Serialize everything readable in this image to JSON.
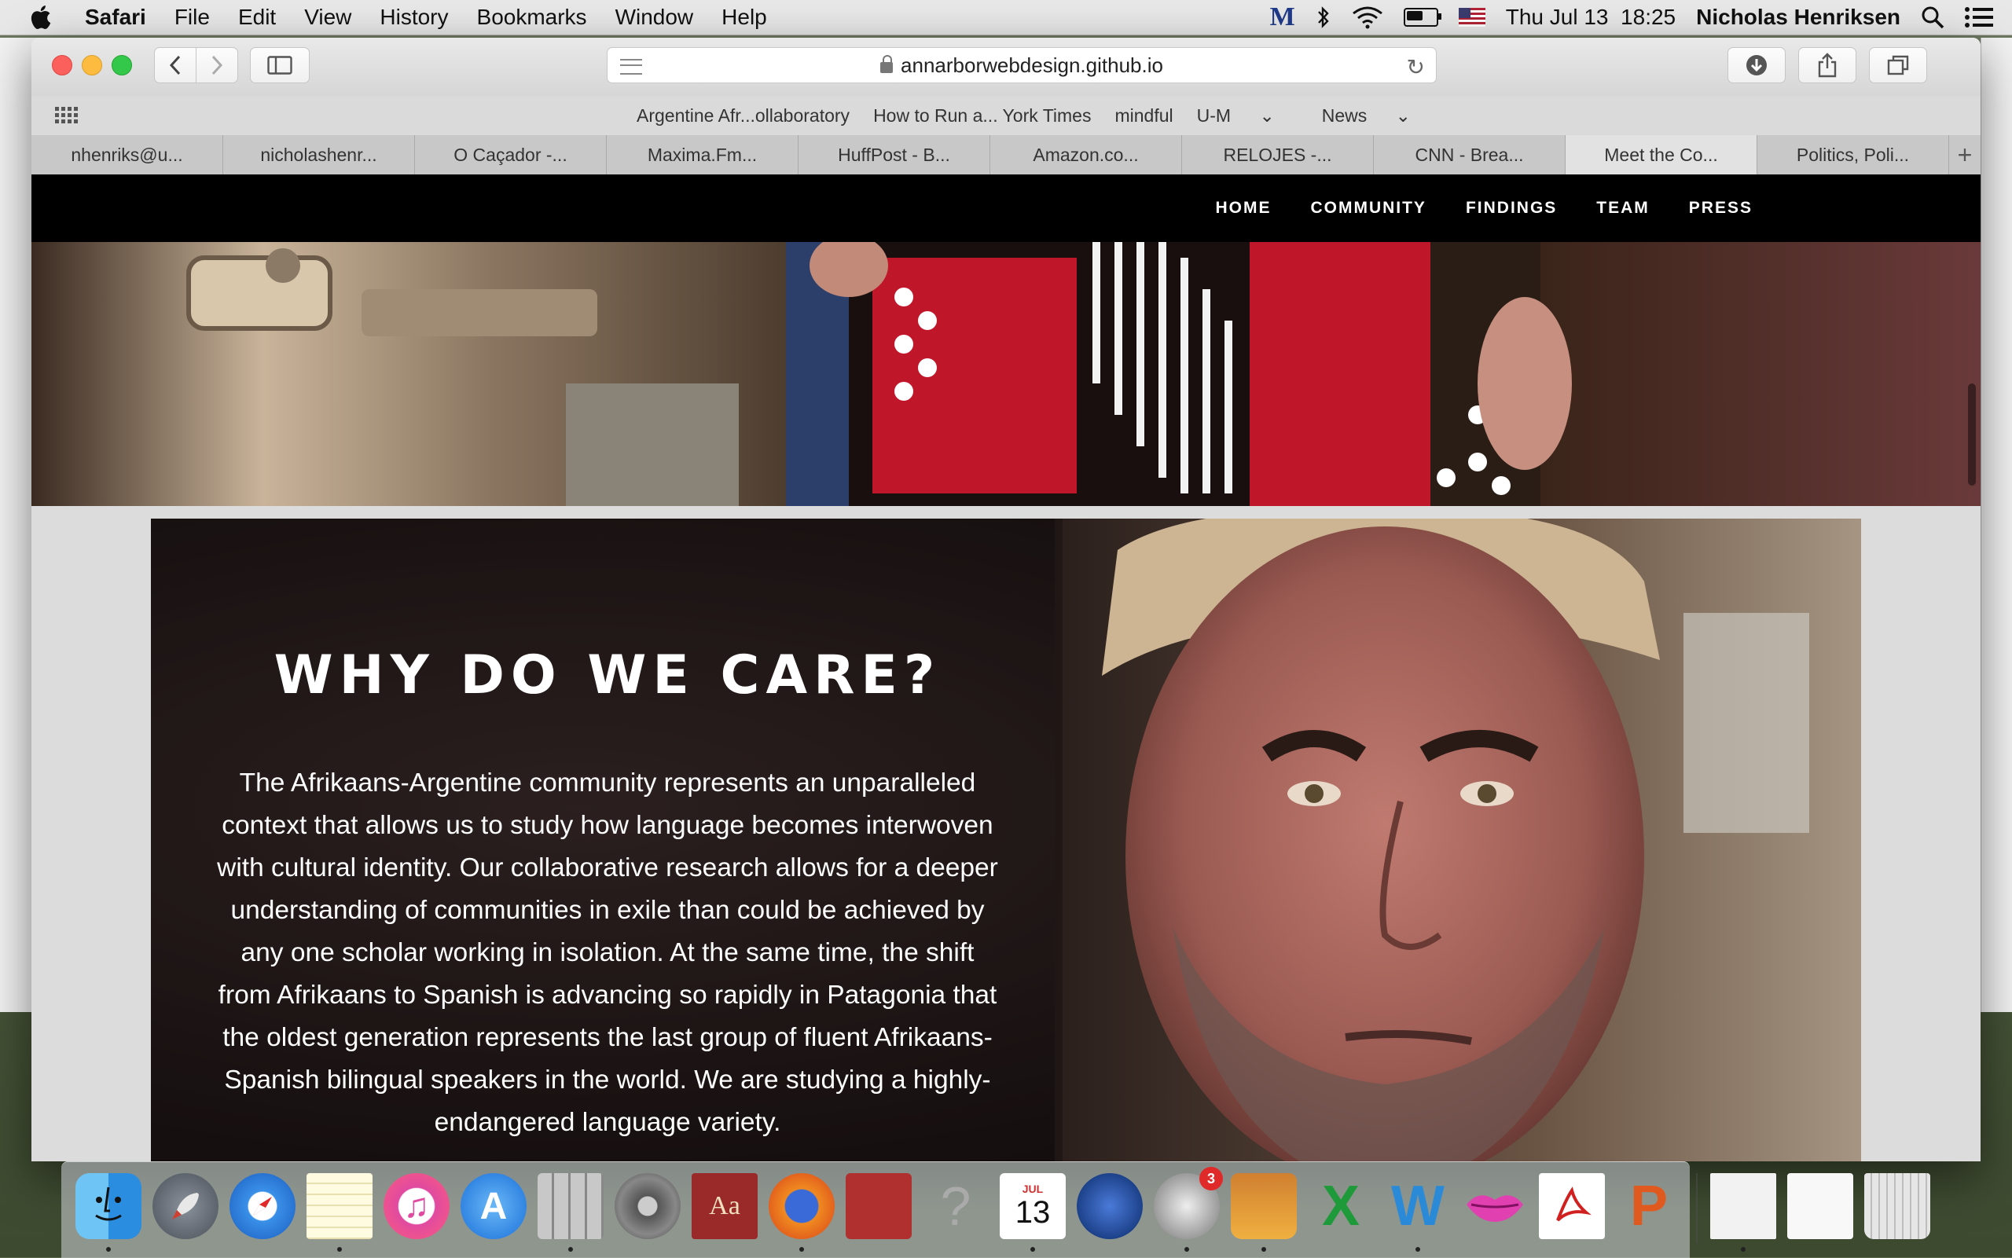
{
  "menubar": {
    "app": "Safari",
    "items": [
      "File",
      "Edit",
      "View",
      "History",
      "Bookmarks",
      "Window",
      "Help"
    ],
    "clock": "Thu Jul 13  18:25",
    "user": "Nicholas Henriksen",
    "status_icons": [
      "michigan-m-icon",
      "bluetooth-icon",
      "wifi-icon",
      "battery-icon",
      "us-flag-icon",
      "search-icon",
      "list-icon"
    ],
    "battery_level": 0.6
  },
  "browser": {
    "url": "annarborwebdesign.github.io",
    "favorites": [
      "Argentine Afr...ollaboratory",
      "How to Run a... York Times",
      "mindful",
      "U-M",
      "News"
    ],
    "tabs": [
      "nhenriks@u...",
      "nicholashenr...",
      "O Caçador -...",
      "Maxima.Fm...",
      "HuffPost - B...",
      "Amazon.co...",
      "RELOJES -...",
      "CNN - Brea...",
      "Meet the Co...",
      "Politics, Poli..."
    ],
    "active_tab_index": 8
  },
  "site": {
    "nav": [
      "HOME",
      "COMMUNITY",
      "FINDINGS",
      "TEAM",
      "PRESS"
    ],
    "heading": "WHY DO WE CARE?",
    "body": "The Afrikaans-Argentine community represents an unparalleled context that allows us to study how language becomes interwoven with cultural identity. Our collaborative research allows for a deeper understanding of communities in exile than could be achieved by any one scholar working in isolation. At the same time, the shift from Afrikaans to Spanish is advancing so rapidly in Patagonia that the oldest generation represents the last group of fluent Afrikaans-Spanish bilingual speakers in the world. We are studying a highly-endangered language variety."
  },
  "dock": {
    "apps": [
      "finder",
      "launchpad",
      "safari",
      "notes",
      "itunes",
      "app-store",
      "calculator",
      "system-preferences",
      "dictionary",
      "firefox",
      "photo-booth",
      "help",
      "calendar",
      "network-utility",
      "mail-drop",
      "script",
      "excel",
      "word",
      "lips",
      "acrobat",
      "powerpoint",
      "document",
      "preview",
      "trash"
    ],
    "calendar_month": "JUL",
    "calendar_day": "13",
    "badge": "3",
    "running": [
      0,
      3,
      6,
      9,
      12,
      14,
      15,
      17,
      21
    ]
  },
  "colors": {
    "nav_bg": "#000000",
    "page_bg": "#dcdcdc",
    "text_light": "#ffffff"
  }
}
